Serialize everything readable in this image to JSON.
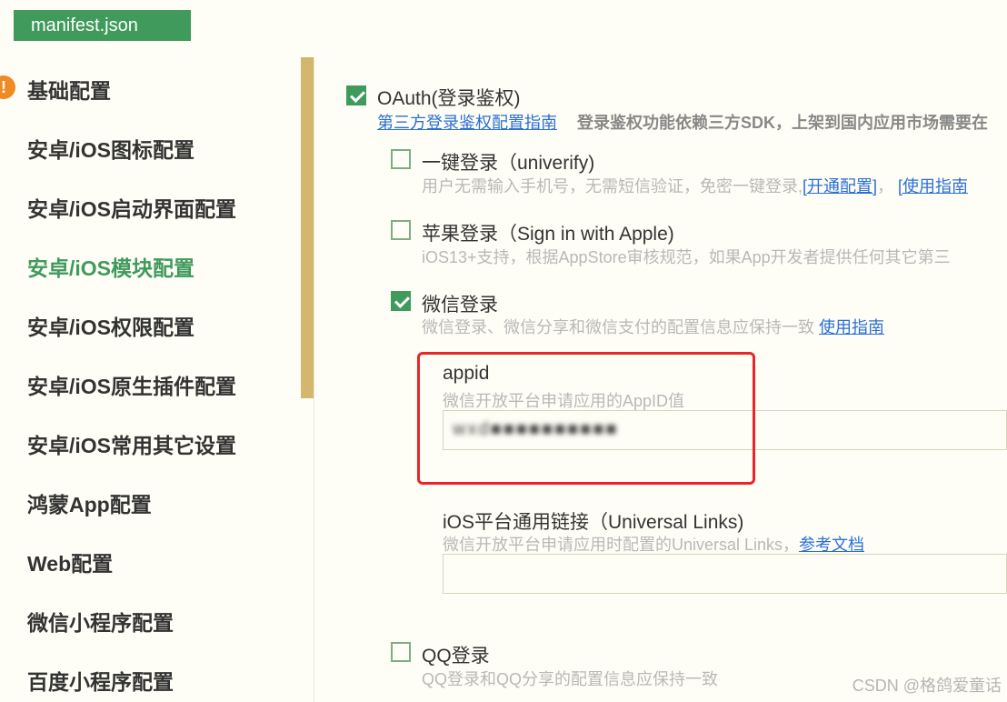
{
  "tab": {
    "label": "manifest.json"
  },
  "sidebar": {
    "items": [
      {
        "label": "基础配置"
      },
      {
        "label": "安卓/iOS图标配置"
      },
      {
        "label": "安卓/iOS启动界面配置"
      },
      {
        "label": "安卓/iOS模块配置"
      },
      {
        "label": "安卓/iOS权限配置"
      },
      {
        "label": "安卓/iOS原生插件配置"
      },
      {
        "label": "安卓/iOS常用其它设置"
      },
      {
        "label": "鸿蒙App配置"
      },
      {
        "label": "Web配置"
      },
      {
        "label": "微信小程序配置"
      },
      {
        "label": "百度小程序配置"
      }
    ]
  },
  "oauth": {
    "label": "OAuth(登录鉴权)",
    "guide_link": "第三方登录鉴权配置指南",
    "guide_desc": "登录鉴权功能依赖三方SDK，上架到国内应用市场需要在"
  },
  "univerify": {
    "label": "一键登录（univerify)",
    "desc": "用户无需输入手机号，无需短信验证，免密一键登录,",
    "link1": "[开通配置]",
    "sep": "，",
    "link2": "[使用指南"
  },
  "apple": {
    "label": "苹果登录（Sign in with Apple)",
    "desc": "iOS13+支持，根据AppStore审核规范，如果App开发者提供任何其它第三"
  },
  "wechat": {
    "label": "微信登录",
    "desc": "微信登录、微信分享和微信支付的配置信息应保持一致",
    "link": "使用指南",
    "appid": {
      "label": "appid",
      "hint": "微信开放平台申请应用的AppID值",
      "value": "wxd■■■■■■■■■■"
    },
    "ulink": {
      "label": "iOS平台通用链接（Universal Links)",
      "hint": "微信开放平台申请应用时配置的Universal Links，",
      "link": "参考文档",
      "value": ""
    }
  },
  "qq": {
    "label": "QQ登录",
    "desc": "QQ登录和QQ分享的配置信息应保持一致"
  },
  "watermark": "CSDN @格鸽爱童话"
}
